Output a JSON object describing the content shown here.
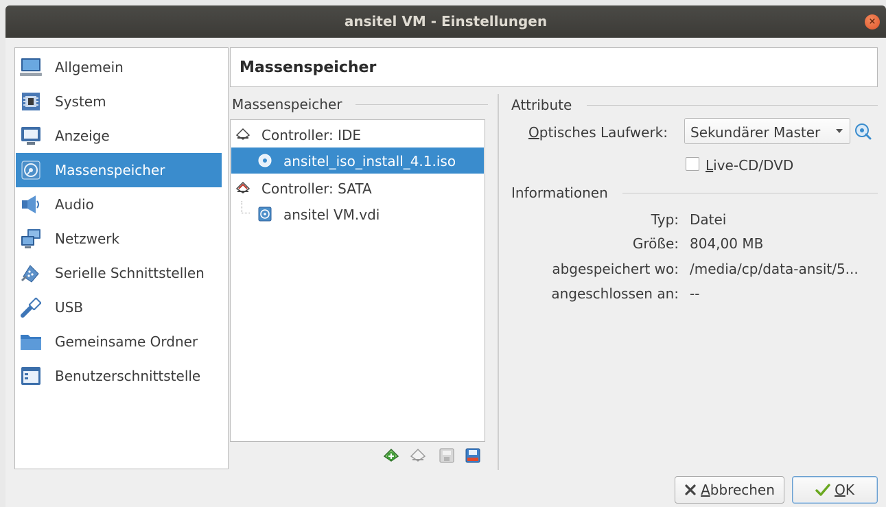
{
  "window": {
    "title": "ansitel VM - Einstellungen",
    "close_glyph": "×"
  },
  "sidebar": {
    "items": [
      {
        "label": "Allgemein",
        "icon": "monitor-icon"
      },
      {
        "label": "System",
        "icon": "chip-icon"
      },
      {
        "label": "Anzeige",
        "icon": "display-icon"
      },
      {
        "label": "Massenspeicher",
        "icon": "disk-icon",
        "selected": true
      },
      {
        "label": "Audio",
        "icon": "speaker-icon"
      },
      {
        "label": "Netzwerk",
        "icon": "network-icon"
      },
      {
        "label": "Serielle Schnittstellen",
        "icon": "serial-port-icon"
      },
      {
        "label": "USB",
        "icon": "usb-icon"
      },
      {
        "label": "Gemeinsame Ordner",
        "icon": "folder-icon"
      },
      {
        "label": "Benutzerschnittstelle",
        "icon": "ui-window-icon"
      }
    ]
  },
  "header": {
    "title": "Massenspeicher"
  },
  "storage": {
    "section_label": "Massenspeicher",
    "tree": [
      {
        "label": "Controller: IDE",
        "type": "controller",
        "icon": "ide-controller-icon"
      },
      {
        "label": "ansitel_iso_install_4.1.iso",
        "type": "optical",
        "icon": "optical-disc-icon",
        "selected": true
      },
      {
        "label": "Controller: SATA",
        "type": "controller",
        "icon": "sata-controller-icon"
      },
      {
        "label": "ansitel VM.vdi",
        "type": "harddisk",
        "icon": "hard-disk-icon"
      }
    ],
    "toolbar": [
      {
        "name": "add-controller-button",
        "icon": "add-controller-icon"
      },
      {
        "name": "remove-controller-button",
        "icon": "remove-controller-icon"
      },
      {
        "name": "add-attachment-button",
        "icon": "add-attachment-icon"
      },
      {
        "name": "remove-attachment-button",
        "icon": "remove-attachment-icon"
      }
    ]
  },
  "attributes": {
    "section_label": "Attribute",
    "optical_drive_label_first": "O",
    "optical_drive_label_rest": "ptisches Laufwerk:",
    "optical_drive_value": "Sekundärer Master",
    "live_cd_first": "L",
    "live_cd_rest": "ive-CD/DVD",
    "live_cd_checked": false
  },
  "information": {
    "section_label": "Informationen",
    "rows": [
      {
        "key": "Typ:",
        "value": "Datei"
      },
      {
        "key": "Größe:",
        "value": "804,00 MB"
      },
      {
        "key": "abgespeichert wo:",
        "value": "/media/cp/data-ansit/5..."
      },
      {
        "key": "angeschlossen an:",
        "value": "--"
      }
    ]
  },
  "buttons": {
    "cancel_first": "A",
    "cancel_rest": "bbrechen",
    "ok_first": "O",
    "ok_rest": "K"
  },
  "colors": {
    "selection": "#3a8ccd",
    "titlebar": "#3c3b37",
    "close_button": "#e0542a"
  }
}
